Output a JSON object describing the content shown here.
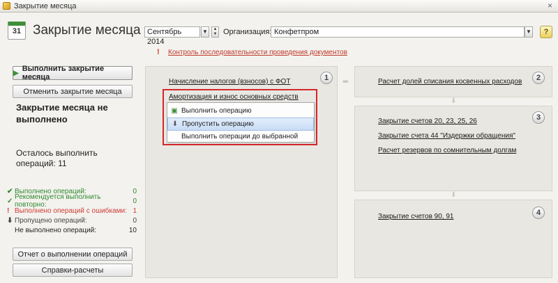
{
  "window": {
    "title": "Закрытие месяца",
    "close_glyph": "×"
  },
  "header": {
    "icon_number": "31",
    "title": "Закрытие месяца",
    "period": "Сентябрь 2014",
    "org_label": "Организация:",
    "org_value": "Конфетпром",
    "help_label": "?"
  },
  "warning": {
    "text": "Контроль последовательности проведения документов"
  },
  "left": {
    "run_label": "Выполнить закрытие месяца",
    "cancel_label": "Отменить закрытие месяца",
    "status_title": "Закрытие месяца не выполнено",
    "remaining": "Осталось выполнить операций: 11",
    "stats": [
      {
        "label": "Выполнено операций:",
        "value": "0"
      },
      {
        "label": "Рекомендуется выполнить повторно:",
        "value": "0"
      },
      {
        "label": "Выполнено операций с ошибками:",
        "value": "1"
      },
      {
        "label": "Пропущено операций:",
        "value": "0"
      },
      {
        "label": "Не выполнено операций:",
        "value": "10"
      }
    ],
    "report_label": "Отчет о выполнении операций",
    "calc_label": "Справки-расчеты"
  },
  "steps": {
    "s1": {
      "num": "1",
      "items": [
        "Начисление налогов (взносов) с ФОТ",
        "Амортизация и износ основных средств"
      ]
    },
    "s2": {
      "num": "2",
      "items": [
        "Расчет долей списания косвенных расходов"
      ]
    },
    "s3": {
      "num": "3",
      "items": [
        "Закрытие счетов 20, 23, 25, 26",
        "Закрытие счета 44 \"Издержки обращения\"",
        "Расчет резервов по сомнительным долгам"
      ]
    },
    "s4": {
      "num": "4",
      "items": [
        "Закрытие счетов 90, 91"
      ]
    }
  },
  "context_menu": {
    "items": [
      "Выполнить операцию",
      "Пропустить операцию",
      "Выполнить операции до выбранной"
    ],
    "selected_index": 1
  },
  "colors": {
    "ok": "#2f8a2f",
    "error": "#cf3b35",
    "highlight": "#d4262a",
    "selected": "#c8dcf6"
  }
}
